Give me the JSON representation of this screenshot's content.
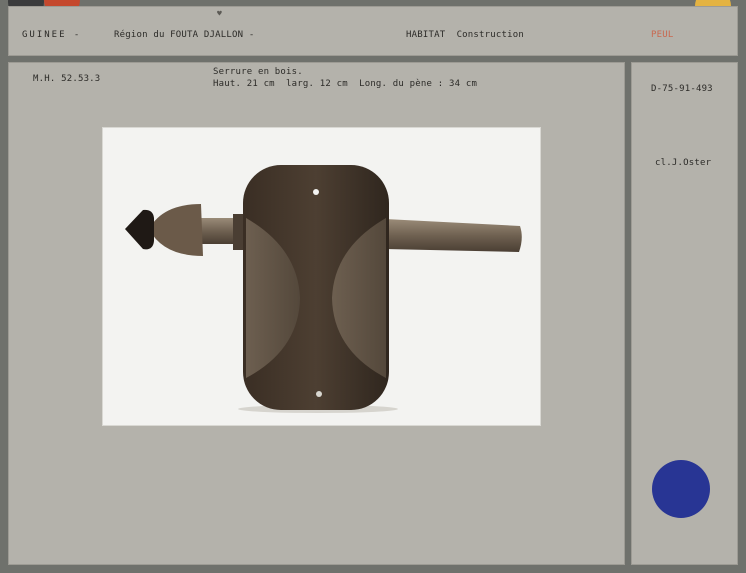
{
  "header": {
    "country": "GUINEE -",
    "region": "Région du FOUTA DJALLON -",
    "category": "HABITAT  Construction",
    "ethnic_group": "PEUL",
    "colors": {
      "group_label": "#c9684f"
    }
  },
  "record": {
    "inventory_number": "M.H. 52.53.3",
    "title": "Serrure en bois.",
    "dimensions": "Haut. 21 cm  larg. 12 cm  Long. du pène : 34 cm"
  },
  "side": {
    "photo_number": "D-75-91-493",
    "collector": "cl.J.Oster"
  },
  "photo": {
    "subject": "wooden-lock"
  },
  "markers": {
    "blue": "#283594",
    "yellow": "#e4b342",
    "red": "#c5482d",
    "dark": "#3a3b3c"
  }
}
